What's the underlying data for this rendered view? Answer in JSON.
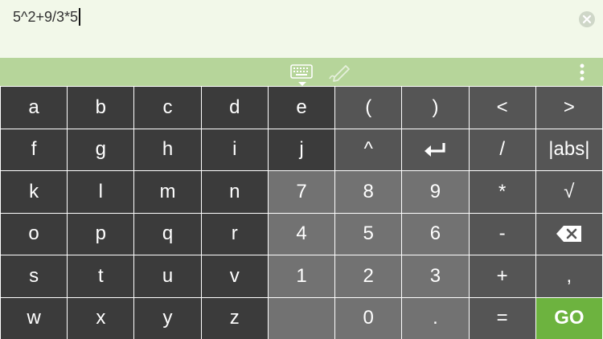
{
  "input": {
    "expression": "5^2+9/3*5"
  },
  "icons": {
    "clear": "clear-icon",
    "keyboard": "keyboard-icon",
    "handwriting": "pen-icon",
    "menu": "more-vert-icon",
    "enter": "enter-icon",
    "backspace": "backspace-icon"
  },
  "colors": {
    "input_bg": "#f2f8e9",
    "toolbar_bg": "#b6d59a",
    "letter_key": "#3b3b3b",
    "symbol_key": "#555555",
    "number_key": "#727272",
    "go_key": "#6db33f"
  },
  "keys": {
    "a": "a",
    "b": "b",
    "c": "c",
    "d": "d",
    "e": "e",
    "f": "f",
    "g": "g",
    "h": "h",
    "i": "i",
    "j": "j",
    "k": "k",
    "l": "l",
    "m": "m",
    "n": "n",
    "o": "o",
    "p": "p",
    "q": "q",
    "r": "r",
    "s": "s",
    "t": "t",
    "u": "u",
    "v": "v",
    "w": "w",
    "x": "x",
    "y": "y",
    "z": "z",
    "open_paren": "(",
    "close_paren": ")",
    "less": "<",
    "greater": ">",
    "caret": "^",
    "slash": "/",
    "abs": "|abs|",
    "seven": "7",
    "eight": "8",
    "nine": "9",
    "multiply": "*",
    "sqrt": "√",
    "four": "4",
    "five": "5",
    "six": "6",
    "minus": "-",
    "one": "1",
    "two": "2",
    "three": "3",
    "plus": "+",
    "comma": ",",
    "zero": "0",
    "dot": ".",
    "equals": "=",
    "go": "GO"
  }
}
